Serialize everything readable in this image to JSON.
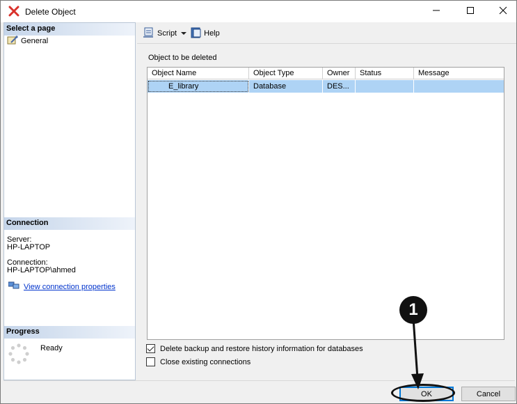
{
  "window": {
    "title": "Delete Object",
    "controls": {
      "minimize": "minimize-icon",
      "maximize": "maximize-icon",
      "close": "close-icon"
    }
  },
  "left": {
    "select_page_header": "Select a page",
    "pages": [
      {
        "label": "General",
        "icon": "wrench-page-icon"
      }
    ],
    "connection_header": "Connection",
    "server_label": "Server:",
    "server_value": "HP-LAPTOP",
    "connection_label": "Connection:",
    "connection_value": "HP-LAPTOP\\ahmed",
    "view_props_link": "View connection properties",
    "progress_header": "Progress",
    "progress_status": "Ready"
  },
  "toolbar": {
    "script_label": "Script",
    "help_label": "Help"
  },
  "main": {
    "section_label": "Object to be deleted",
    "columns": [
      "Object Name",
      "Object Type",
      "Owner",
      "Status",
      "Message"
    ],
    "rows": [
      {
        "name": "E_library",
        "type": "Database",
        "owner": "DES...",
        "status": "",
        "message": ""
      }
    ],
    "options": [
      {
        "label": "Delete backup and restore history information for databases",
        "checked": true
      },
      {
        "label": "Close existing connections",
        "checked": false
      }
    ]
  },
  "buttons": {
    "ok": "OK",
    "cancel": "Cancel"
  },
  "annotation": {
    "step": "1"
  },
  "colors": {
    "selection": "#aed3f5",
    "header_gradient": "#c5d5ea",
    "link": "#0033cc",
    "close_x": "#d9312b"
  }
}
